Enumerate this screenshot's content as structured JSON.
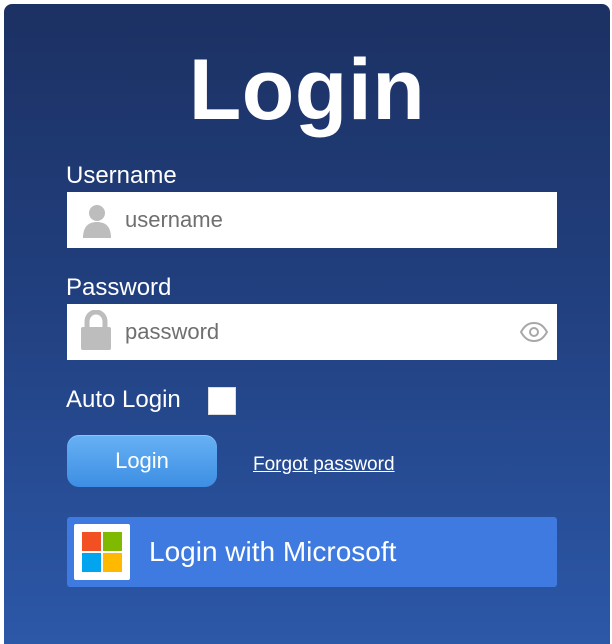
{
  "title": "Login",
  "username": {
    "label": "Username",
    "placeholder": "username",
    "value": "",
    "icon": "user-icon"
  },
  "password": {
    "label": "Password",
    "placeholder": "password",
    "value": "",
    "icon": "lock-icon",
    "toggle_icon": "eye-icon"
  },
  "auto_login": {
    "label": "Auto Login",
    "checked": false
  },
  "login_button": {
    "label": "Login"
  },
  "forgot_password": {
    "label": "Forgot password"
  },
  "microsoft_button": {
    "label": "Login with Microsoft",
    "icon": "microsoft-logo-icon"
  },
  "colors": {
    "panel_top": "#1c3163",
    "panel_bottom": "#2c58a8",
    "login_button": "#4a9bea",
    "microsoft_button": "#3e7ae0",
    "ms_red": "#f25022",
    "ms_green": "#7fba00",
    "ms_blue": "#00a4ef",
    "ms_yellow": "#ffb900"
  }
}
